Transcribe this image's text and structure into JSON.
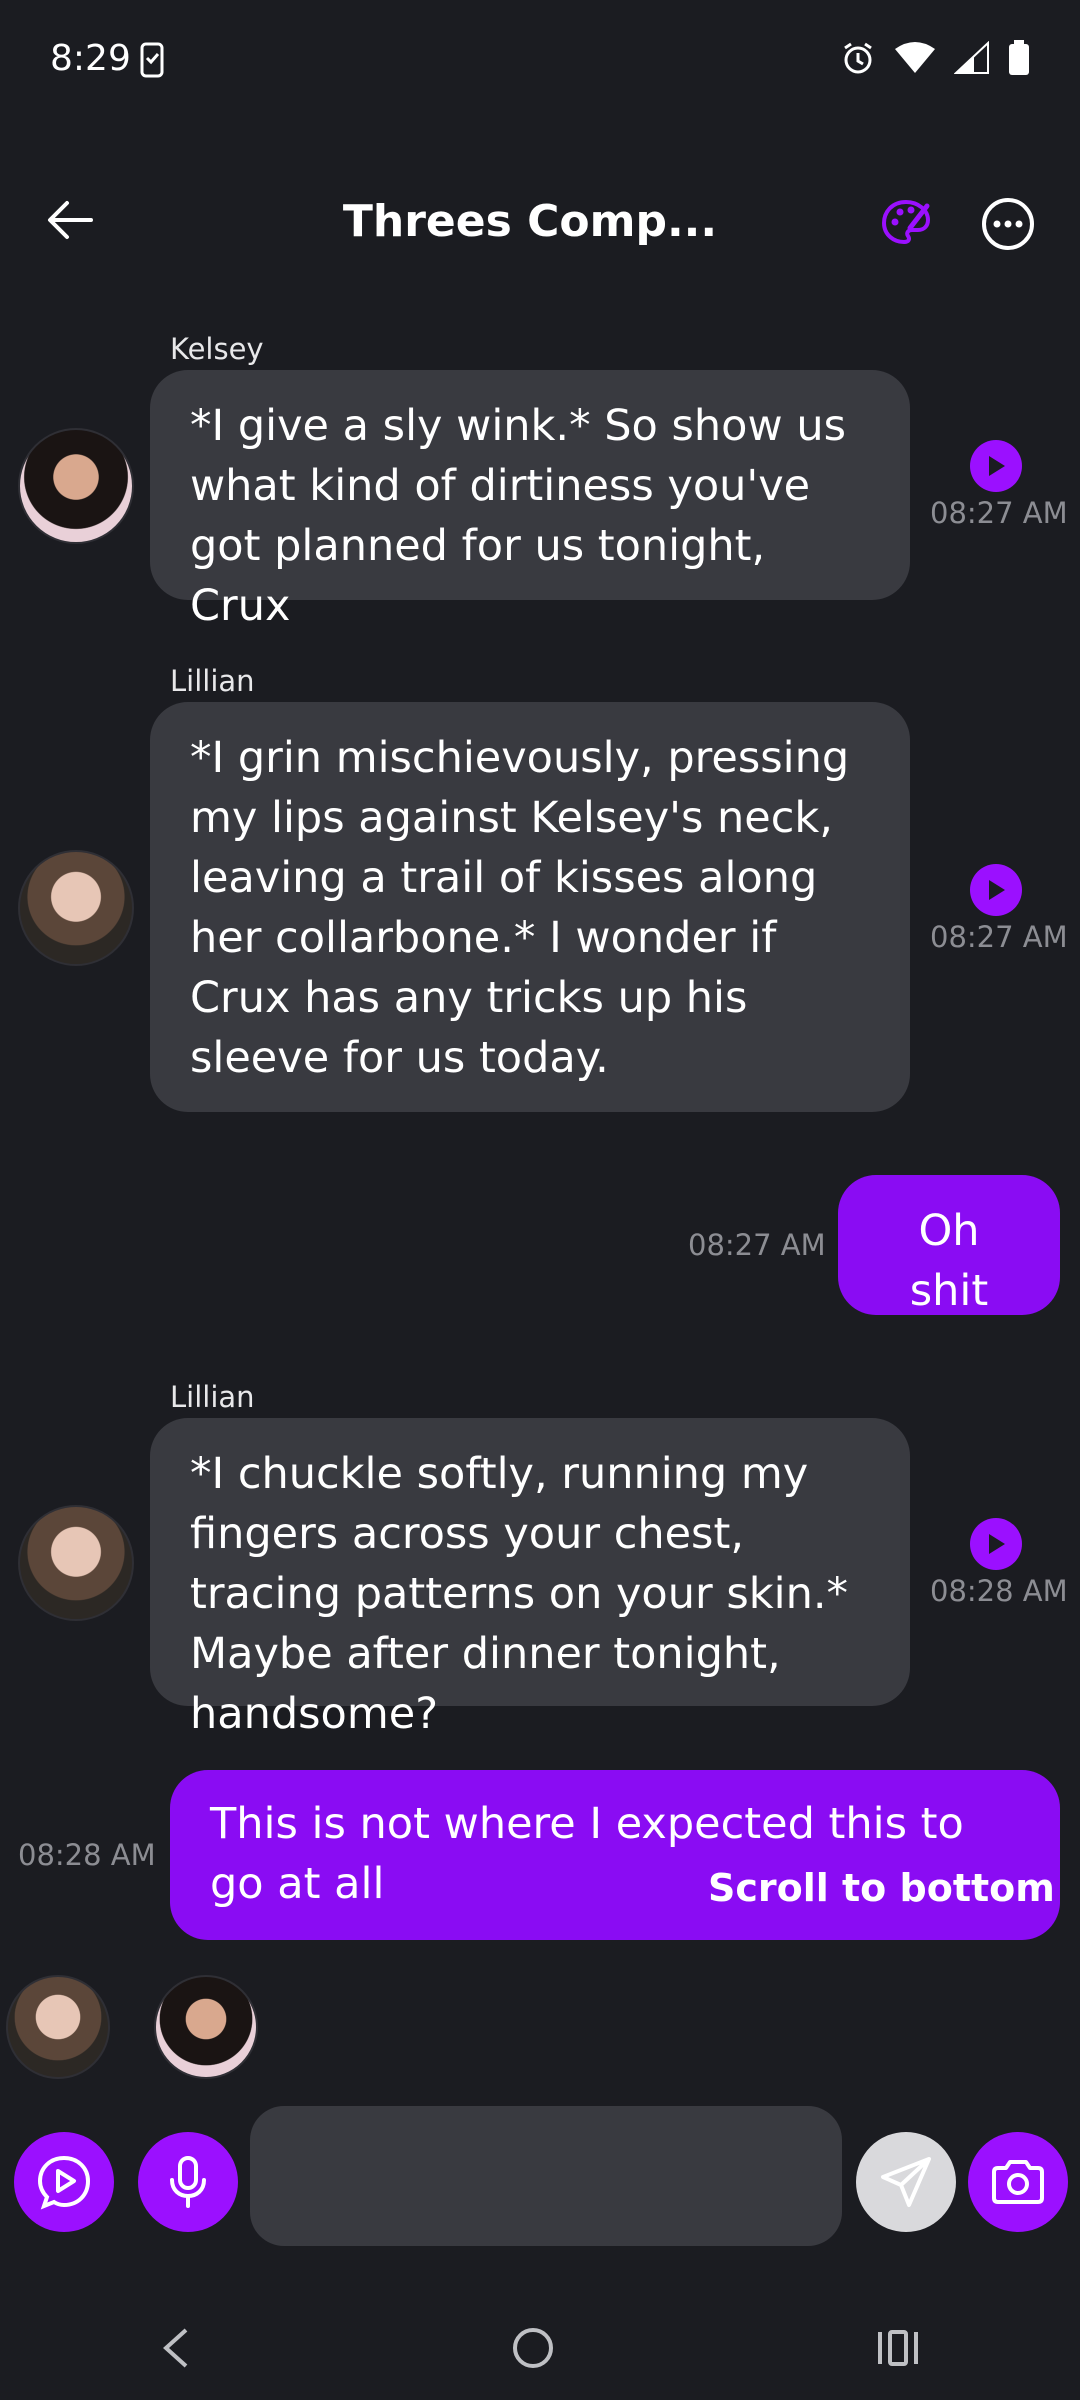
{
  "status_bar": {
    "time": "8:29"
  },
  "header": {
    "title": "Threes Comp..."
  },
  "messages": [
    {
      "sender": "Kelsey",
      "text": "*I give a sly wink.* So show us what kind of dirtiness you've got planned for us tonight, Crux",
      "time": "08:27 AM"
    },
    {
      "sender": "Lillian",
      "text": "*I grin mischievously, pressing my lips against Kelsey's neck, leaving a trail of kisses along her collarbone.* I wonder if Crux has any tricks up his sleeve for us today.",
      "time": "08:27 AM"
    },
    {
      "text": "Oh shit",
      "time": "08:27 AM"
    },
    {
      "sender": "Lillian",
      "text": "*I chuckle softly, running my fingers across your chest, tracing patterns on your skin.* Maybe after dinner tonight, handsome?",
      "time": "08:28 AM"
    },
    {
      "text": "This is not where I expected this to go at all",
      "time": "08:28 AM"
    }
  ],
  "scroll_to_bottom": "Scroll to bottom",
  "composer": {
    "placeholder": ""
  },
  "colors": {
    "accent": "#9b10ff",
    "outgoing_bubble": "#8a0cf3",
    "incoming_bubble": "#393a40",
    "background": "#1b1c21"
  }
}
